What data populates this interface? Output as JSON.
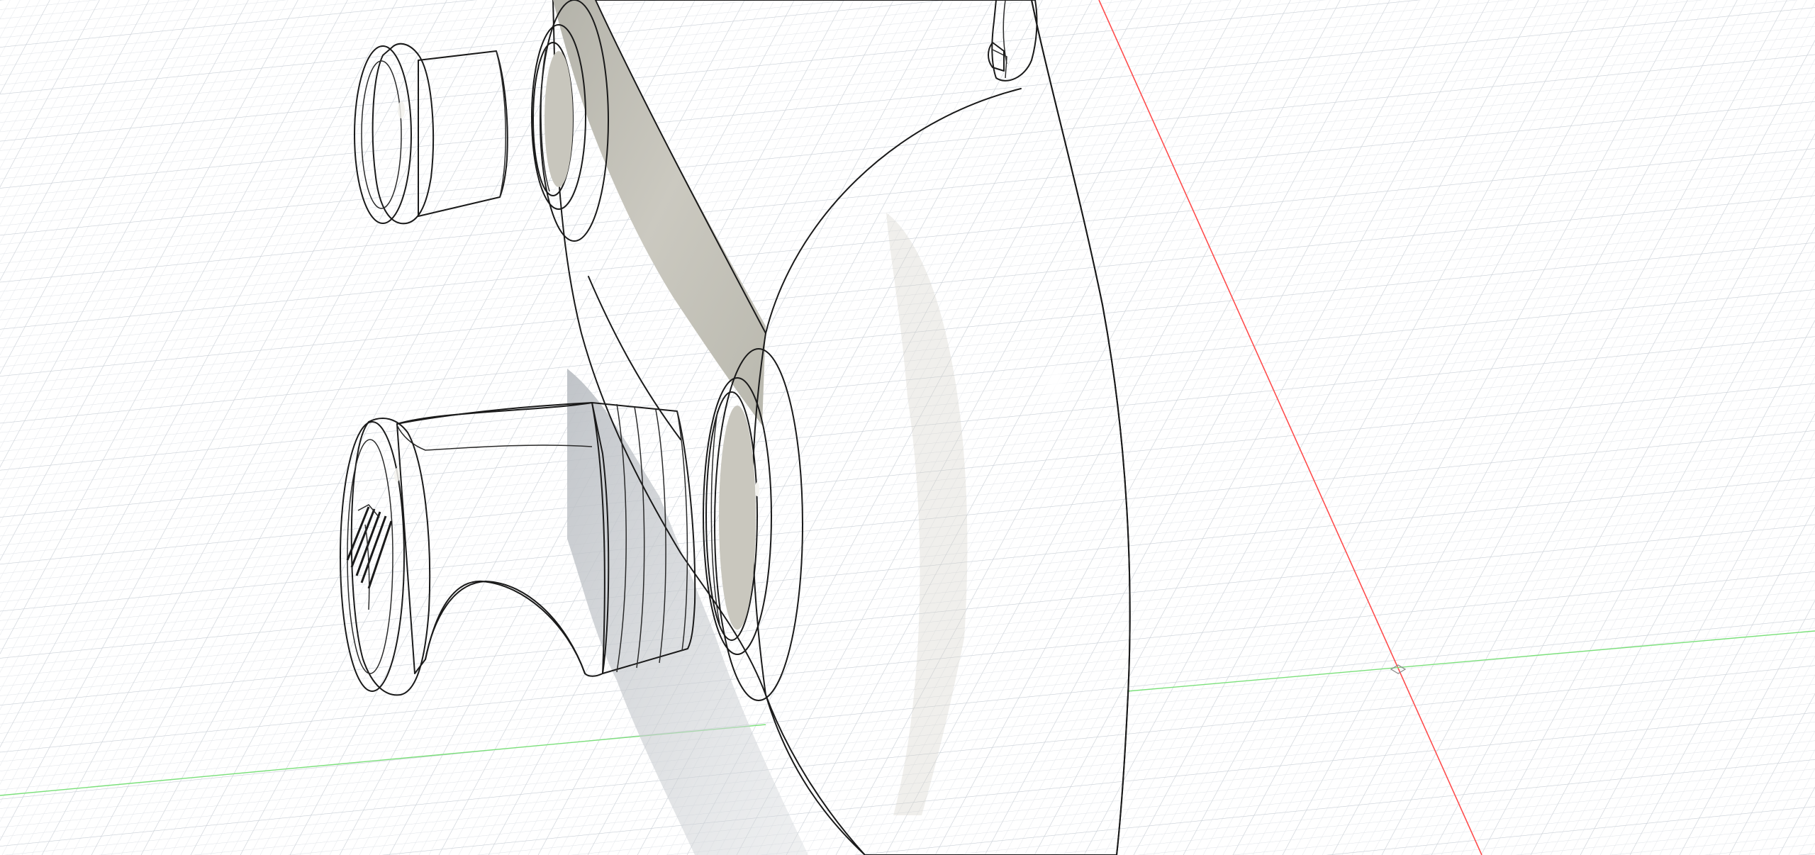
{
  "viewport": {
    "background": "#ffffff",
    "colors": {
      "grid_minor": "#d9dee3",
      "grid_major": "#c4cad1",
      "x_axis": "#ff4d4d",
      "y_axis": "#66dd66",
      "model_body": "#c2c0b6",
      "model_shade": "#a8a79e",
      "model_highlight": "#e4e3dc",
      "model_edges": "#1a1a1a"
    }
  },
  "model": {
    "parts": [
      "main-housing",
      "top-knob",
      "top-socket",
      "bottom-knob-with-stem",
      "bottom-socket",
      "top-tab"
    ]
  }
}
